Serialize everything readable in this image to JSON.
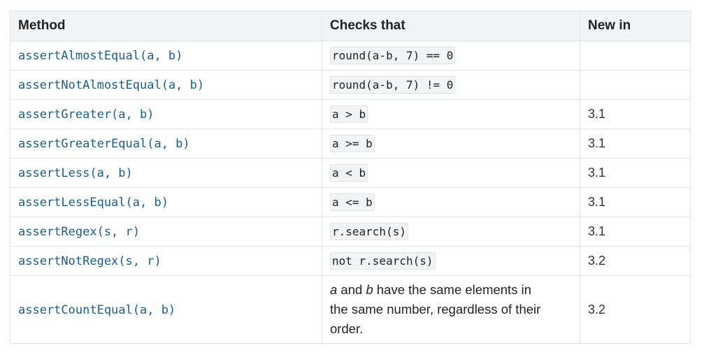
{
  "table": {
    "headers": [
      "Method",
      "Checks that",
      "New in"
    ],
    "rows": [
      {
        "method": "assertAlmostEqual(a, b)",
        "check": "round(a-b, 7) == 0",
        "new_in": ""
      },
      {
        "method": "assertNotAlmostEqual(a, b)",
        "check": "round(a-b, 7) != 0",
        "new_in": ""
      },
      {
        "method": "assertGreater(a, b)",
        "check": "a > b",
        "new_in": "3.1"
      },
      {
        "method": "assertGreaterEqual(a, b)",
        "check": "a >= b",
        "new_in": "3.1"
      },
      {
        "method": "assertLess(a, b)",
        "check": "a < b",
        "new_in": "3.1"
      },
      {
        "method": "assertLessEqual(a, b)",
        "check": "a <= b",
        "new_in": "3.1"
      },
      {
        "method": "assertRegex(s, r)",
        "check": "r.search(s)",
        "new_in": "3.1"
      },
      {
        "method": "assertNotRegex(s, r)",
        "check": "not r.search(s)",
        "new_in": "3.2"
      },
      {
        "method": "assertCountEqual(a, b)",
        "check_text": {
          "var_a": "a",
          "and": " and ",
          "var_b": "b",
          "line1_rest": " have the same elements in",
          "line2": "the same number, regardless of their",
          "line3": "order."
        },
        "new_in": "3.2"
      }
    ]
  }
}
